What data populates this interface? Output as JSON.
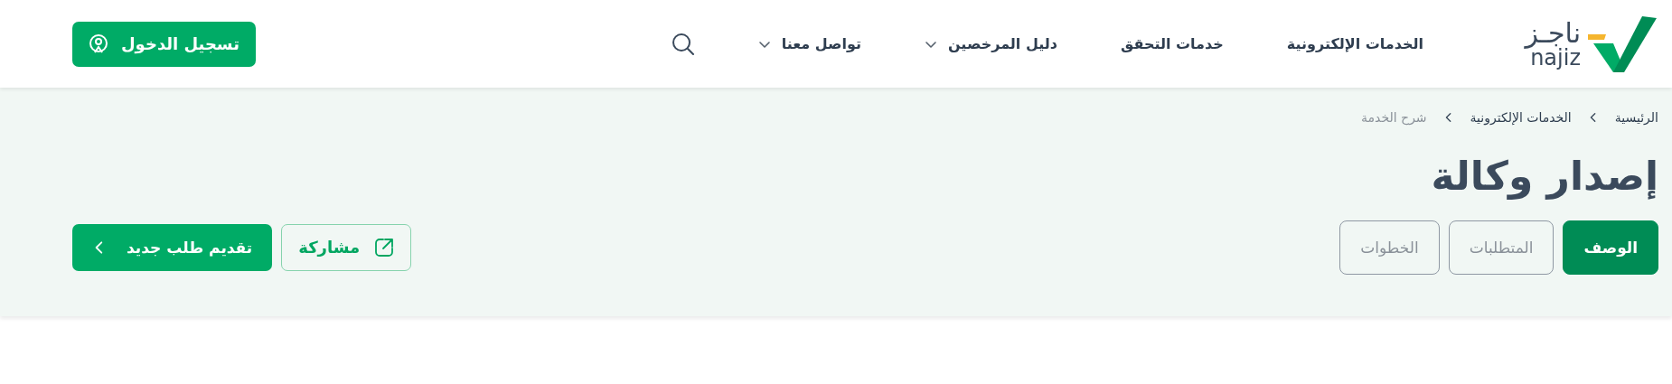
{
  "logo": {
    "arabic": "ناجـز",
    "latin": "najiz"
  },
  "nav": [
    {
      "label": "الخدمات الإلكترونية",
      "dropdown": false
    },
    {
      "label": "خدمات التحقق",
      "dropdown": false
    },
    {
      "label": "دليل المرخصين",
      "dropdown": true
    },
    {
      "label": "تواصل معنا",
      "dropdown": true
    }
  ],
  "login_button": "تسجيل الدخول",
  "breadcrumb": [
    {
      "label": "الرئيسية",
      "current": false
    },
    {
      "label": "الخدمات الإلكترونية",
      "current": false
    },
    {
      "label": "شرح الخدمة",
      "current": true
    }
  ],
  "title": "إصدار وكالة",
  "tabs": [
    {
      "label": "الوصف",
      "selected": true
    },
    {
      "label": "المتطلبات",
      "selected": false
    },
    {
      "label": "الخطوات",
      "selected": false
    }
  ],
  "share_button": "مشاركة",
  "new_request_button": "تقديم طلب جديد"
}
